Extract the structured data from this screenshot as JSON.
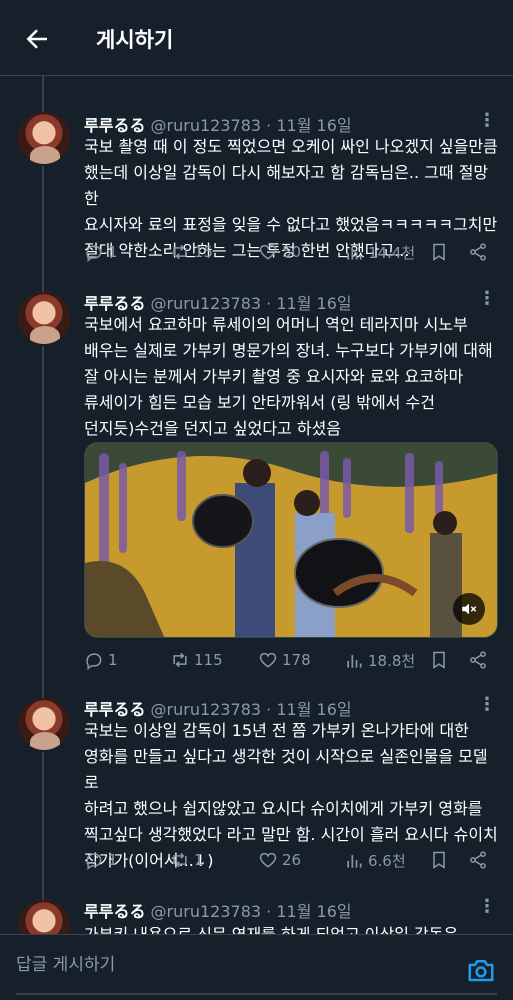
{
  "header": {
    "title": "게시하기"
  },
  "prev_tweet_actions": {
    "retweets": "33",
    "likes": "59",
    "views": "11천"
  },
  "tweets": [
    {
      "name": "루루るる",
      "handle": "@ruru123783",
      "dot": "·",
      "date": "11월 16일",
      "text": "국보 촬영 때 이 정도 찍었으면 오케이 싸인 나오겠지 싶을만큼\n했는데 이상일 감독이 다시 해보자고 함 감독님은.. 그때 절망한\n요시자와 료의 표정을 잊을 수 없다고 했었음ㅋㅋㅋㅋㅋ그치만\n절대 약한소리 안하는 그는 투정 한번 안했다고...",
      "replies": "1",
      "retweets": "15",
      "likes": "50",
      "views": "14.4천"
    },
    {
      "name": "루루るる",
      "handle": "@ruru123783",
      "dot": "·",
      "date": "11월 16일",
      "text": "국보에서 요코하마 류세이의 어머니 역인 테라지마 시노부\n배우는 실제로 가부키 명문가의 장녀. 누구보다 가부키에 대해\n잘 아시는 분께서  가부키 촬영 중 요시자와 료와 요코하마\n류세이가 힘든 모습 보기 안타까워서 (링 밖에서 수건\n던지듯)수건을 던지고 싶었다고 하셨음",
      "replies": "1",
      "retweets": "115",
      "likes": "178",
      "views": "18.8천"
    },
    {
      "name": "루루るる",
      "handle": "@ruru123783",
      "dot": "·",
      "date": "11월 16일",
      "text": "국보는 이상일 감독이 15년 전 쯤 가부키 온나가타에 대한\n영화를 만들고 싶다고 생각한 것이 시작으로 실존인물을 모델로\n하려고 했으나 쉽지않았고 요시다 슈이치에게 가부키 영화를\n찍고싶다 생각했었다 라고 말만 함. 시간이 흘러 요시다 슈이치\n작가가(이어서...↓)",
      "replies": "1",
      "retweets": "1",
      "likes": "26",
      "views": "6.6천"
    },
    {
      "name": "루루るる",
      "handle": "@ruru123783",
      "dot": "·",
      "date": "11월 16일",
      "text": "가부키 내용으로 신문 연재를 하게 되었고 이상일 감독은"
    }
  ],
  "reply_bar": {
    "placeholder": "답글 게시하기"
  },
  "colors": {
    "background": "#15202b",
    "muted": "#8b98a5",
    "accent": "#1d9bf0",
    "border": "#38444d"
  }
}
